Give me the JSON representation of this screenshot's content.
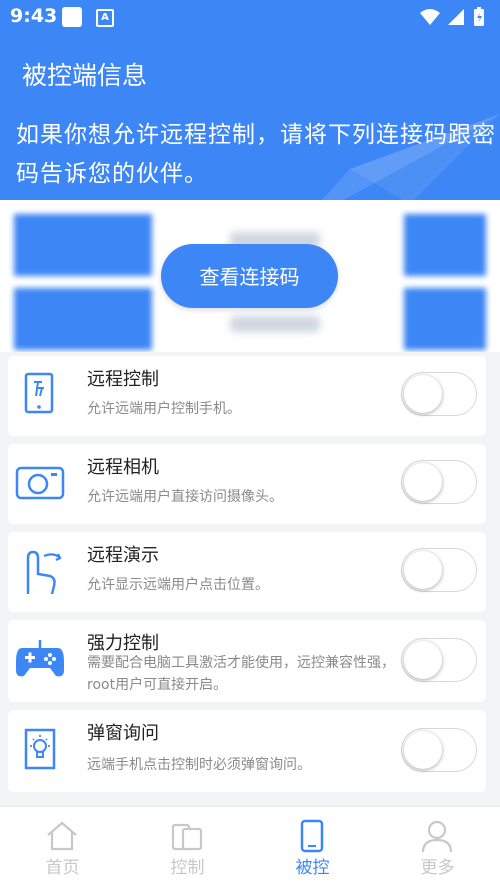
{
  "status_bar": {
    "time": "9:43",
    "app_icon_letter": "A"
  },
  "header": {
    "title": "被控端信息",
    "description": "如果你想允许远程控制，请将下列连接码跟密码告诉您的伙伴。"
  },
  "show_code_button": "查看连接码",
  "features": [
    {
      "title": "远程控制",
      "desc": "允许远端用户控制手机。",
      "icon": "tablet-hand-icon",
      "enabled": false
    },
    {
      "title": "远程相机",
      "desc": "允许远端用户直接访问摄像头。",
      "icon": "camera-icon",
      "enabled": false
    },
    {
      "title": "远程演示",
      "desc": "允许显示远端用户点击位置。",
      "icon": "tap-gesture-icon",
      "enabled": false
    },
    {
      "title": "强力控制",
      "desc": "需要配合电脑工具激活才能使用，远控兼容性强，root用户可直接开启。",
      "icon": "gamepad-icon",
      "enabled": false
    },
    {
      "title": "弹窗询问",
      "desc": "远端手机点击控制时必须弹窗询问。",
      "icon": "lightbulb-icon",
      "enabled": false
    }
  ],
  "bottom_nav": [
    {
      "label": "首页",
      "icon": "home-icon",
      "active": false
    },
    {
      "label": "控制",
      "icon": "devices-icon",
      "active": false
    },
    {
      "label": "被控",
      "icon": "phone-icon",
      "active": true
    },
    {
      "label": "更多",
      "icon": "person-icon",
      "active": false
    }
  ],
  "colors": {
    "primary": "#3d86f5",
    "inactive_nav": "#c8c8c8",
    "subtitle": "#8a8a8a"
  }
}
